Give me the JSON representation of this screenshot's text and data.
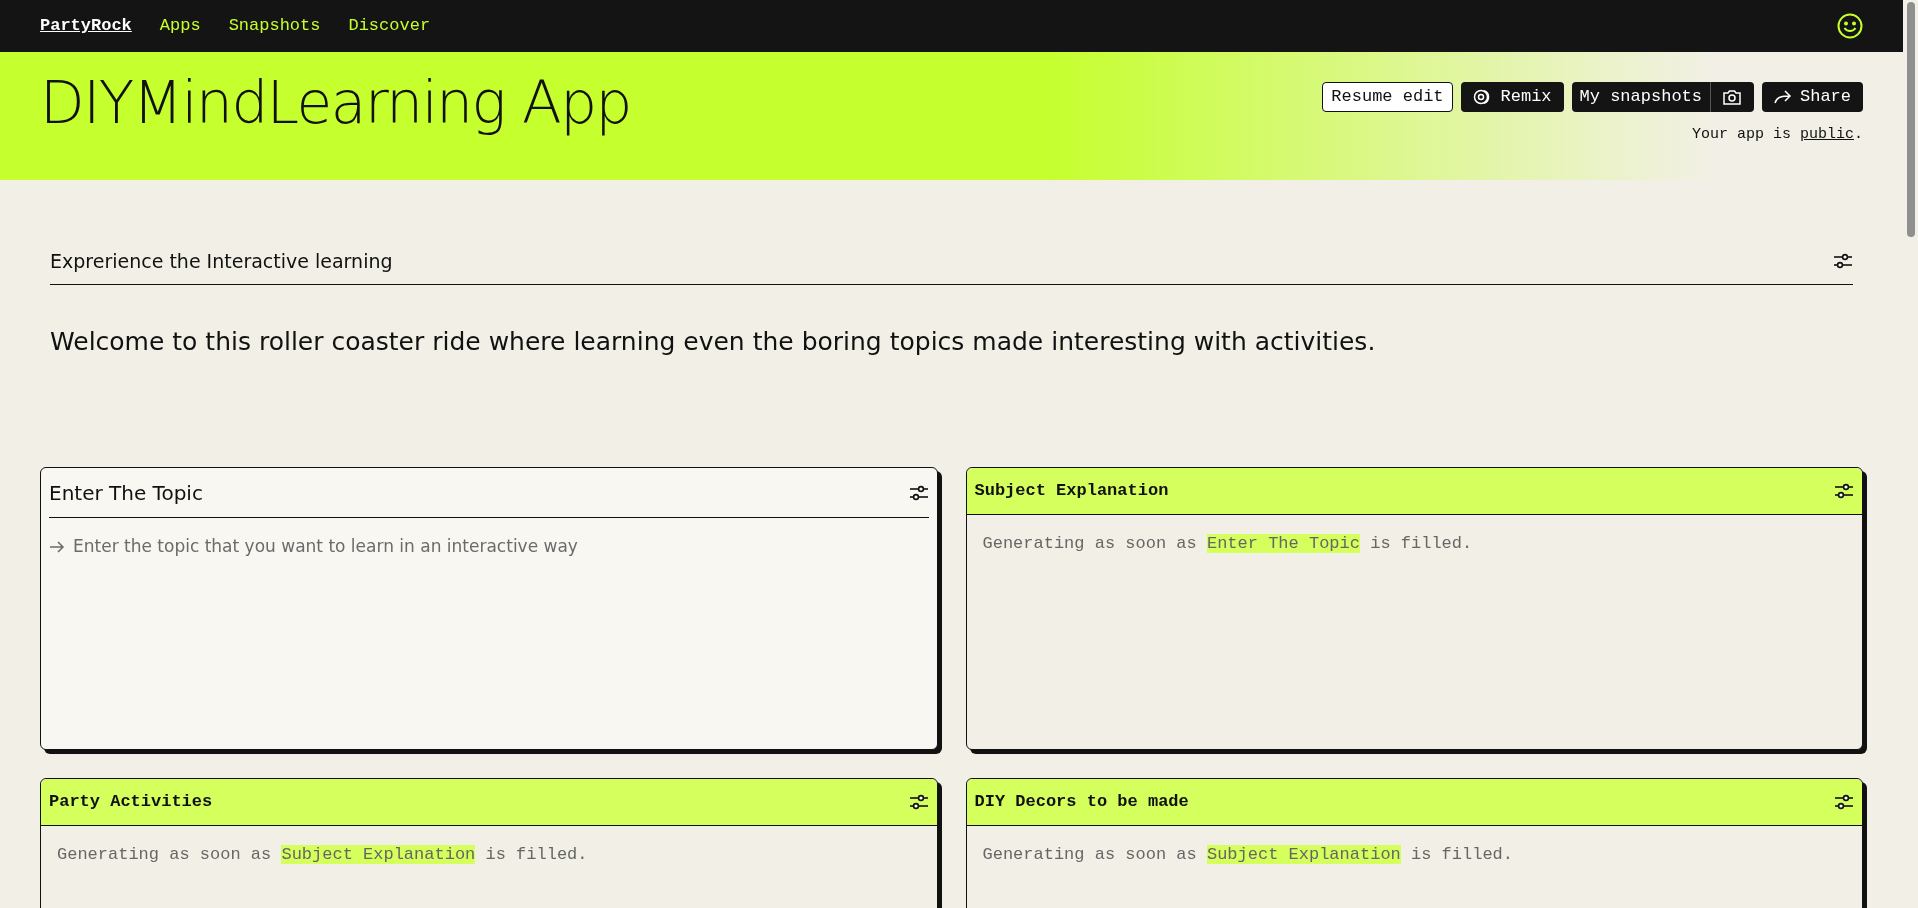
{
  "nav": {
    "brand": "PartyRock",
    "links": [
      "Apps",
      "Snapshots",
      "Discover"
    ]
  },
  "header": {
    "title": "DIYMindLearning App",
    "resume_button": "Resume edit",
    "remix_button": "Remix",
    "snapshots_button": "My snapshots",
    "share_button": "Share",
    "visibility_prefix": "Your app is ",
    "visibility_link": "public",
    "visibility_suffix": "."
  },
  "intro": {
    "heading": "Exprerience the Interactive learning",
    "text": "Welcome to this roller coaster ride where learning even the boring topics made interesting with activities."
  },
  "widgets": [
    {
      "kind": "input",
      "title": "Enter The Topic",
      "placeholder": "Enter the topic that you want to learn in an interactive way"
    },
    {
      "kind": "output",
      "title": "Subject Explanation",
      "status_prefix": "Generating as soon as",
      "source": "Enter The Topic",
      "status_suffix": "is filled."
    },
    {
      "kind": "output",
      "title": "Party Activities",
      "status_prefix": "Generating as soon as",
      "source": "Subject Explanation",
      "status_suffix": "is filled."
    },
    {
      "kind": "output",
      "title": "DIY Decors to be made",
      "status_prefix": "Generating as soon as",
      "source": "Subject Explanation",
      "status_suffix": "is filled."
    }
  ]
}
